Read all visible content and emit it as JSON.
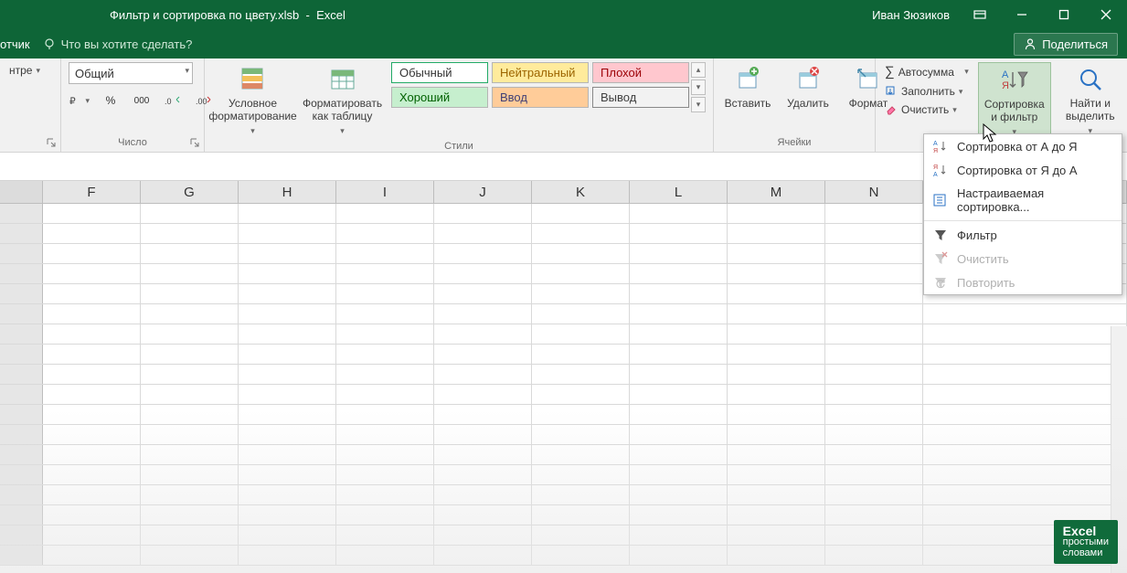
{
  "titlebar": {
    "filename": "Фильтр и сортировка по цвету.xlsb",
    "appname": "Excel",
    "user": "Иван Зюзиков"
  },
  "tellbar": {
    "tab_stub": "отчик",
    "tellme_placeholder": "Что вы хотите сделать?",
    "share": "Поделиться"
  },
  "ribbon": {
    "alignment": {
      "center": "нтре",
      "label": "",
      "wrap": ""
    },
    "number": {
      "format_selected": "Общий",
      "percent": "%",
      "comma": "000",
      "inc": "",
      "dec": "",
      "label": "Число"
    },
    "styles": {
      "cond_format": "Условное форматирование",
      "format_table": "Форматировать как таблицу",
      "cells": {
        "normal": "Обычный",
        "neutral": "Нейтральный",
        "bad": "Плохой",
        "good": "Хороший",
        "input": "Ввод",
        "output": "Вывод"
      },
      "label": "Стили"
    },
    "cells_group": {
      "insert": "Вставить",
      "delete": "Удалить",
      "format": "Формат",
      "label": "Ячейки"
    },
    "editing": {
      "autosum": "Автосумма",
      "fill": "Заполнить",
      "clear": "Очистить",
      "sort": "Сортировка и фильтр",
      "find": "Найти и выделить"
    }
  },
  "dropdown": {
    "sort_az": "Сортировка от А до Я",
    "sort_za": "Сортировка от Я до А",
    "custom": "Настраиваемая сортировка...",
    "filter": "Фильтр",
    "clear": "Очистить",
    "repeat": "Повторить"
  },
  "columns": [
    "F",
    "G",
    "H",
    "I",
    "J",
    "K",
    "L",
    "M",
    "N"
  ],
  "watermark": {
    "brand": "Excel",
    "line1": "простыми",
    "line2": "словами"
  }
}
